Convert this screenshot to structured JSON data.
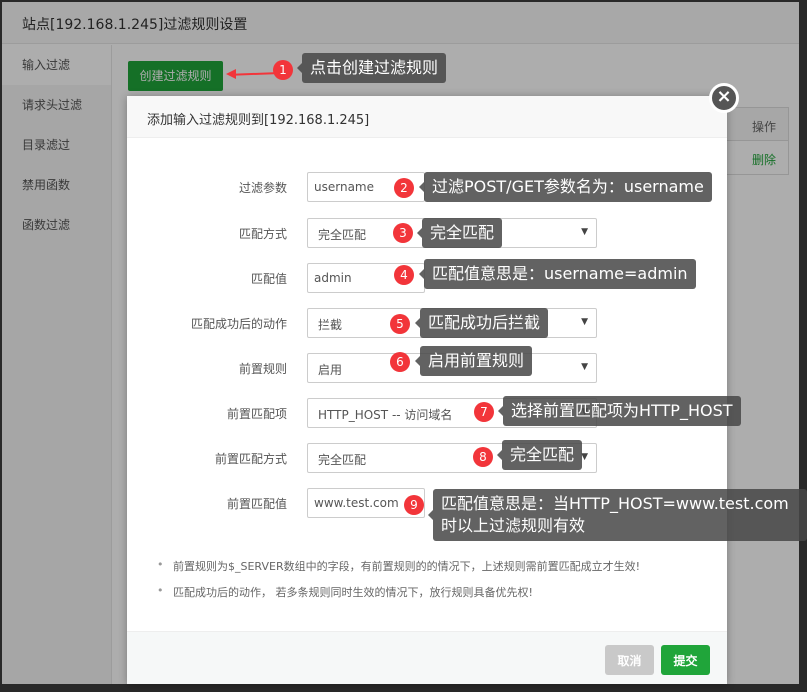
{
  "outer_window": {
    "title": "站点[192.168.1.245]过滤规则设置",
    "sidebar": [
      {
        "label": "输入过滤",
        "active": true
      },
      {
        "label": "请求头过滤",
        "active": false
      },
      {
        "label": "目录滤过",
        "active": false
      },
      {
        "label": "禁用函数",
        "active": false
      },
      {
        "label": "函数过滤",
        "active": false
      }
    ],
    "create_button": "创建过滤规则",
    "table": {
      "header_action": "操作",
      "row_action": "删除"
    }
  },
  "modal": {
    "title": "添加输入过滤规则到[192.168.1.245]",
    "close_icon": "×",
    "fields": [
      {
        "label": "过滤参数",
        "type": "input",
        "value": "username"
      },
      {
        "label": "匹配方式",
        "type": "select",
        "value": "完全匹配"
      },
      {
        "label": "匹配值",
        "type": "input",
        "value": "admin"
      },
      {
        "label": "匹配成功后的动作",
        "type": "select",
        "value": "拦截"
      },
      {
        "label": "前置规则",
        "type": "select",
        "value": "启用"
      },
      {
        "label": "前置匹配项",
        "type": "select",
        "value": "HTTP_HOST -- 访问域名"
      },
      {
        "label": "前置匹配方式",
        "type": "select",
        "value": "完全匹配"
      },
      {
        "label": "前置匹配值",
        "type": "input",
        "value": "www.test.com"
      }
    ],
    "hints": [
      "前置规则为$_SERVER数组中的字段，有前置规则的的情况下，上述规则需前置匹配成立才生效!",
      "匹配成功后的动作， 若多条规则同时生效的情况下，放行规则具备优先权!"
    ],
    "cancel_label": "取消",
    "submit_label": "提交"
  },
  "annotations": [
    {
      "num": "1",
      "text": "点击创建过滤规则"
    },
    {
      "num": "2",
      "text": "过滤POST/GET参数名为：username"
    },
    {
      "num": "3",
      "text": "完全匹配"
    },
    {
      "num": "4",
      "text": "匹配值意思是：username=admin"
    },
    {
      "num": "5",
      "text": "匹配成功后拦截"
    },
    {
      "num": "6",
      "text": "启用前置规则"
    },
    {
      "num": "7",
      "text": "选择前置匹配项为HTTP_HOST"
    },
    {
      "num": "8",
      "text": "完全匹配"
    },
    {
      "num": "9",
      "text": "匹配值意思是：当HTTP_HOST=www.test.com时以上过滤规则有效"
    }
  ],
  "colors": {
    "accent_green": "#20a53a",
    "badge_red": "#f2353a",
    "note_bg": "#464646"
  }
}
